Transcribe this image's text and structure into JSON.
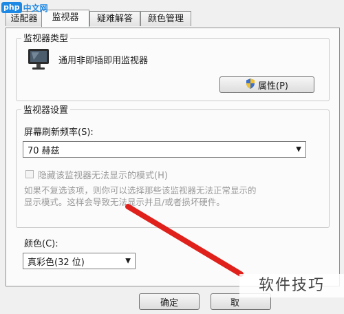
{
  "watermark": {
    "logo_badge": "php",
    "logo_text": "中文网",
    "corner_text": "软件技巧"
  },
  "tabs": [
    {
      "label": "适配器"
    },
    {
      "label": "监视器"
    },
    {
      "label": "疑难解答"
    },
    {
      "label": "颜色管理"
    }
  ],
  "monitor_type": {
    "title": "监视器类型",
    "monitor_name": "通用非即插即用监视器",
    "properties_button": "属性(P)"
  },
  "monitor_settings": {
    "title": "监视器设置",
    "refresh_label": "屏幕刷新频率(S):",
    "refresh_value": "70 赫兹",
    "hide_modes_label": "隐藏该监视器无法显示的模式(H)",
    "hide_modes_checked": false,
    "help_text_line1": "如果不复选该项，则你可以选择那些该监视器无法正常显示的",
    "help_text_line2": "显示模式。这样会导致无法显示并且/或者损坏硬件。"
  },
  "colors": {
    "label": "颜色(C):",
    "value": "真彩色(32 位)"
  },
  "footer": {
    "ok_button": "确定",
    "cancel_button_partial": "取"
  },
  "accent_colors": {
    "annotation_red": "#e0201b",
    "logo_blue": "#1e88e5"
  }
}
